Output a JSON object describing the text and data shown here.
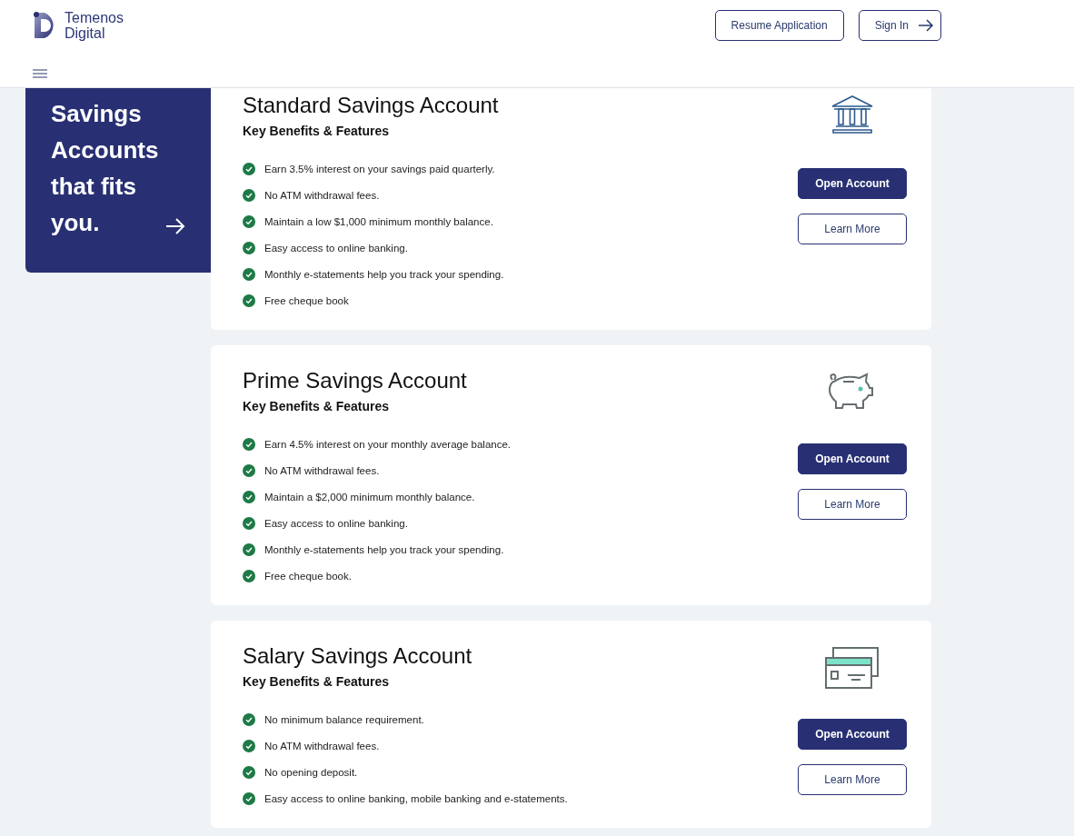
{
  "header": {
    "logo": {
      "line_1": "Temenos",
      "line_2": "Digital"
    },
    "buttons": [
      {
        "label": "Resume Application",
        "kind": "plain"
      },
      {
        "label": "Sign In",
        "kind": "arrow"
      }
    ]
  },
  "hero": {
    "title": "Savings Accounts that fits you."
  },
  "accounts": [
    {
      "title": "Standard Savings Account",
      "subtitle": "Key Benefits & Features",
      "kind": "bank",
      "features": [
        "Earn 3.5% interest on your savings paid quarterly.",
        "No ATM withdrawal fees.",
        "Maintain a low $1,000 minimum monthly balance.",
        "Easy access to online banking.",
        "Monthly e-statements help you track your spending.",
        "Free cheque book"
      ],
      "primary": "Open Account",
      "secondary": "Learn More"
    },
    {
      "title": "Prime Savings Account",
      "subtitle": "Key Benefits & Features",
      "kind": "piggy",
      "features": [
        "Earn 4.5% interest on your monthly average balance.",
        "No ATM withdrawal fees.",
        "Maintain a $2,000 minimum monthly balance.",
        "Easy access to online banking.",
        "Monthly e-statements help you track your spending.",
        "Free cheque book."
      ],
      "primary": "Open Account",
      "secondary": "Learn More"
    },
    {
      "title": "Salary Savings Account",
      "subtitle": "Key Benefits & Features",
      "kind": "card",
      "features": [
        "No minimum balance requirement.",
        "No ATM withdrawal fees.",
        "No opening deposit.",
        "Easy access to online banking, mobile banking and e-statements."
      ],
      "primary": "Open Account",
      "secondary": "Learn More"
    }
  ]
}
